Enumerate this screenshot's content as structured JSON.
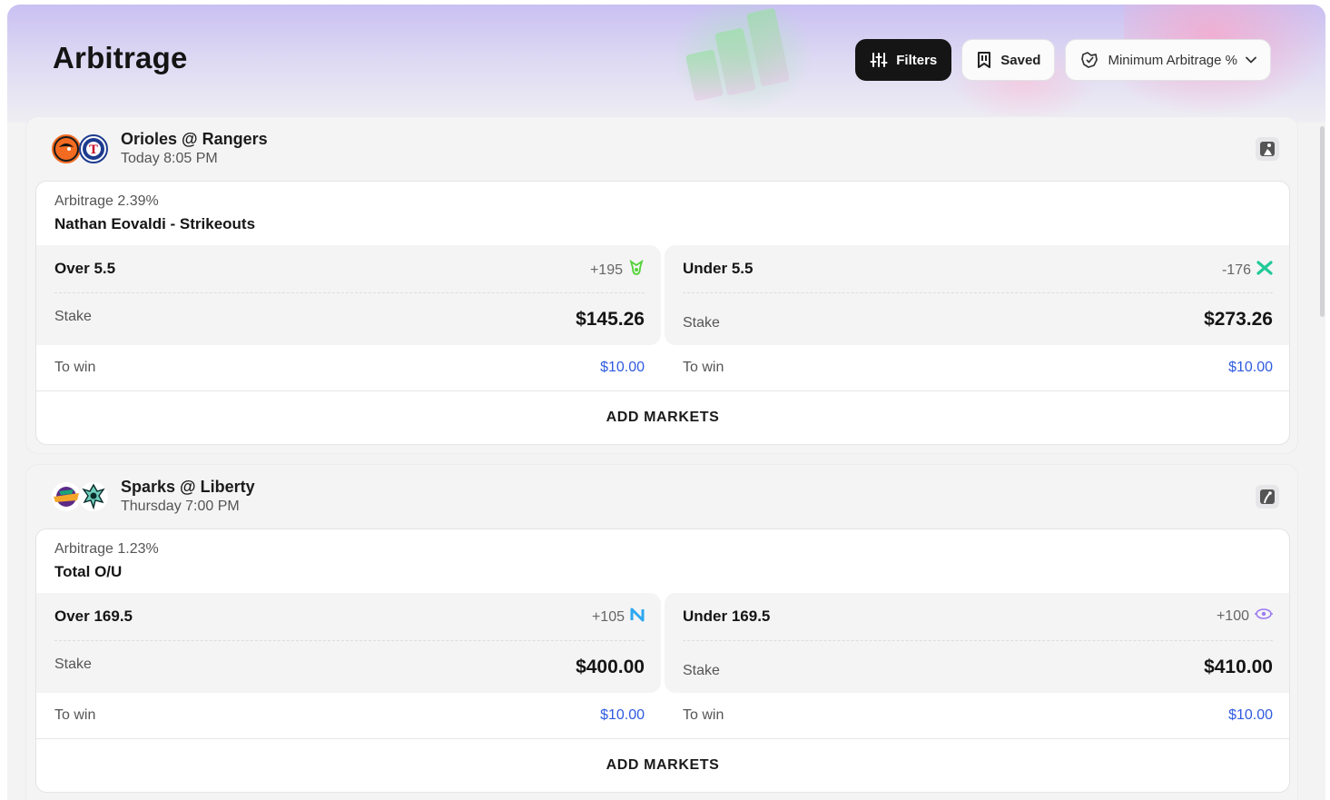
{
  "page": {
    "title": "Arbitrage"
  },
  "toolbar": {
    "filters_label": "Filters",
    "saved_label": "Saved",
    "min_arb_label": "Minimum Arbitrage %"
  },
  "colors": {
    "accent_blue": "#2f5be0",
    "orioles": "#f26b21",
    "rangers": "#1d3b8f",
    "draftkings_green": "#53d337",
    "fanatics_green": "#20c997",
    "novig_blue": "#2da8f0",
    "prophetx_purple": "#9d7cf0"
  },
  "events": [
    {
      "teams": "Orioles @ Rangers",
      "time": "Today 8:05 PM",
      "logos": [
        "orioles-logo",
        "rangers-logo"
      ],
      "league_icon": "mlb-icon",
      "market": {
        "arbitrage": "Arbitrage 2.39%",
        "name": "Nathan Eovaldi - Strikeouts",
        "sides": [
          {
            "label": "Over 5.5",
            "odds": "+195",
            "book_icon": "draftkings-icon",
            "stake_label": "Stake",
            "stake": "$145.26",
            "win_label": "To win",
            "win": "$10.00"
          },
          {
            "label": "Under 5.5",
            "odds": "-176",
            "book_icon": "fanatics-icon",
            "stake_label": "Stake",
            "stake": "$273.26",
            "win_label": "To win",
            "win": "$10.00"
          }
        ],
        "add_markets_label": "ADD MARKETS"
      }
    },
    {
      "teams": "Sparks @ Liberty",
      "time": "Thursday 7:00 PM",
      "logos": [
        "sparks-logo",
        "liberty-logo"
      ],
      "league_icon": "wnba-icon",
      "market": {
        "arbitrage": "Arbitrage 1.23%",
        "name": "Total O/U",
        "sides": [
          {
            "label": "Over 169.5",
            "odds": "+105",
            "book_icon": "novig-icon",
            "stake_label": "Stake",
            "stake": "$400.00",
            "win_label": "To win",
            "win": "$10.00"
          },
          {
            "label": "Under 169.5",
            "odds": "+100",
            "book_icon": "prophetx-icon",
            "stake_label": "Stake",
            "stake": "$410.00",
            "win_label": "To win",
            "win": "$10.00"
          }
        ],
        "add_markets_label": "ADD MARKETS"
      }
    }
  ]
}
